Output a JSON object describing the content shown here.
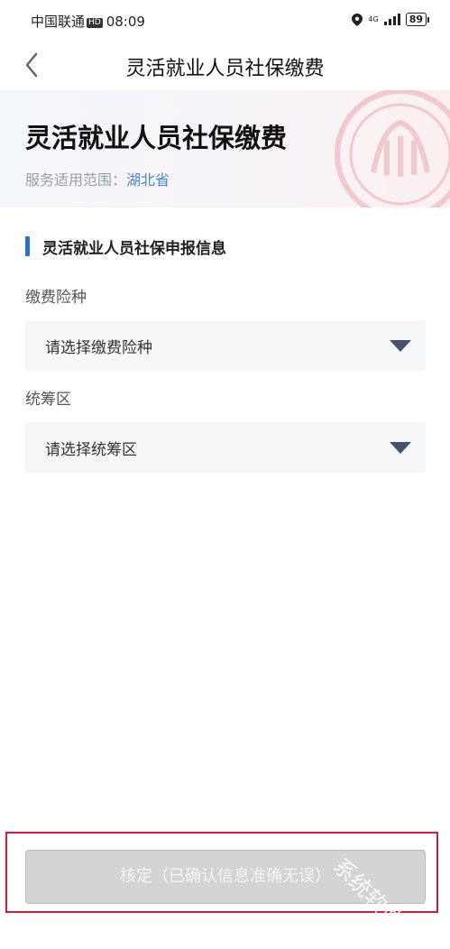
{
  "status_bar": {
    "carrier": "中国联通",
    "hd": "HD",
    "time": "08:09",
    "network": "4G",
    "battery": "89"
  },
  "nav": {
    "title": "灵活就业人员社保缴费",
    "back_icon": "chevron-left-icon"
  },
  "banner": {
    "title": "灵活就业人员社保缴费",
    "scope_label": "服务适用范围：",
    "scope_value": "湖北省"
  },
  "form": {
    "section_title": "灵活就业人员社保申报信息",
    "fields": [
      {
        "label": "缴费险种",
        "placeholder": "请选择缴费险种",
        "icon": "caret-down-icon"
      },
      {
        "label": "统筹区",
        "placeholder": "请选择统筹区",
        "icon": "caret-down-icon"
      }
    ]
  },
  "footer": {
    "confirm_label": "核定（已确认信息准确无误）",
    "watermark": "系统软件站"
  },
  "colors": {
    "accent": "#2f6fc0",
    "link": "#4a86c8",
    "highlight_border": "#d11f3a",
    "disabled_button": "#d3d3d3"
  }
}
